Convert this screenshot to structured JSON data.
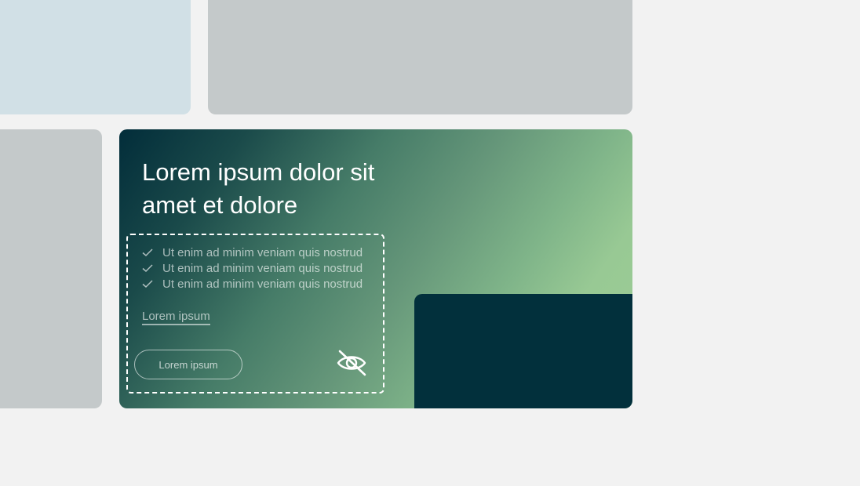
{
  "hero": {
    "title_line1": "Lorem ipsum dolor sit",
    "title_line2": "amet et dolore",
    "checklist": [
      "Ut enim ad minim veniam quis nostrud",
      "Ut enim ad minim veniam quis nostrud",
      "Ut enim ad minim veniam quis nostrud"
    ],
    "link_label": "Lorem ipsum",
    "button_label": "Lorem ipsum",
    "hidden_icon": "eye-off-icon",
    "checklist_icon": "checkmark-icon"
  },
  "colors": {
    "page_background": "#f2f2f2",
    "tile_blue": "#d1e0e6",
    "tile_grey": "#c4c9ca",
    "gradient_dark": "#022d3a",
    "gradient_light": "#9dcd97",
    "dark_block": "#02303c"
  }
}
